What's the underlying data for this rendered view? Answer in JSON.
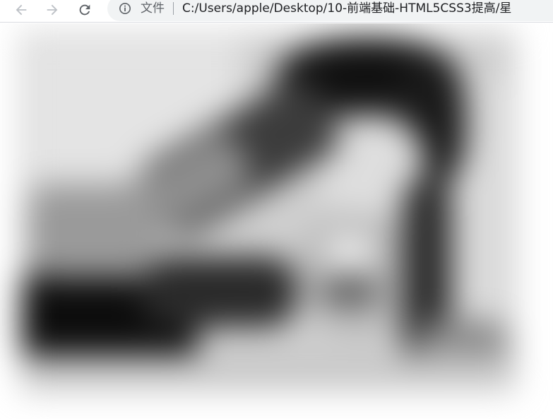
{
  "browser": {
    "security_label": "文件",
    "url": "C:/Users/apple/Desktop/10-前端基础-HTML5CSS3提高/星"
  },
  "icons": {
    "back": "arrow-left-icon",
    "forward": "arrow-right-icon",
    "reload": "reload-icon",
    "info": "info-circle-icon"
  },
  "colors": {
    "icon": "#5f6368",
    "icon_disabled": "#bdc1c6",
    "omnibox_bg": "#f1f3f4"
  },
  "content": {
    "image_effect": "blur",
    "image_color_mode": "grayscale"
  }
}
